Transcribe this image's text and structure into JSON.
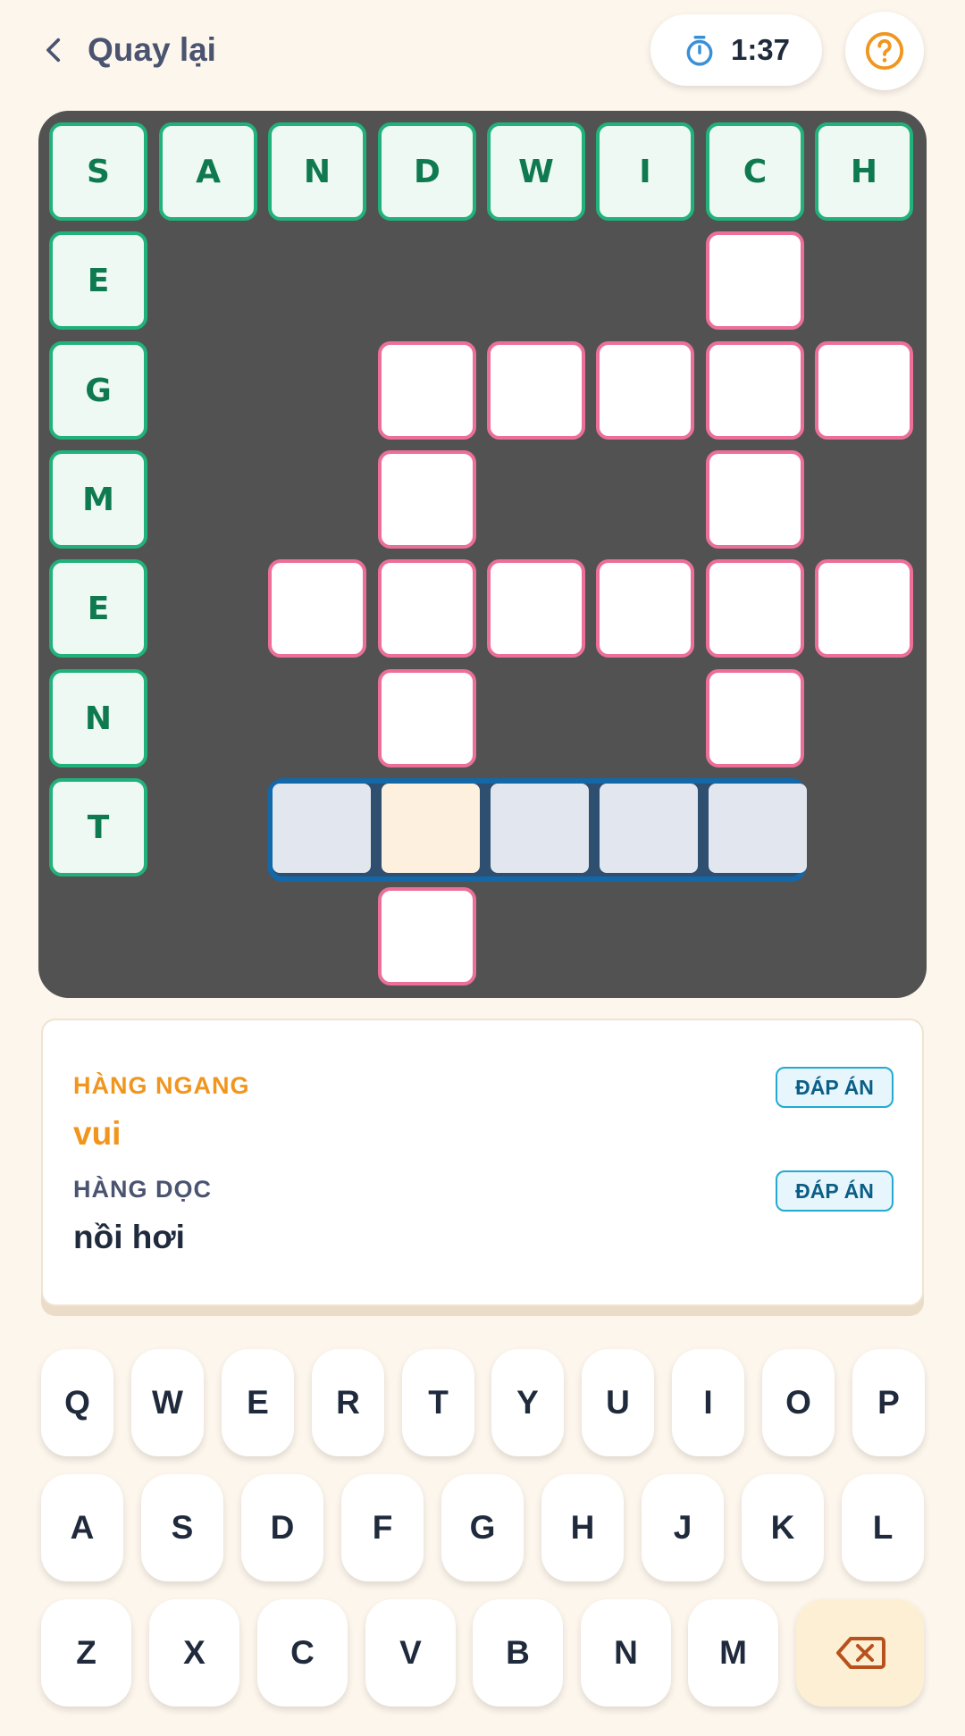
{
  "header": {
    "back_label": "Quay lại",
    "timer": "1:37"
  },
  "board": {
    "solved_row": [
      "S",
      "A",
      "N",
      "D",
      "W",
      "I",
      "C",
      "H"
    ],
    "solved_col": [
      "E",
      "G",
      "M",
      "E",
      "N",
      "T"
    ]
  },
  "clues": {
    "across_heading": "HÀNG NGANG",
    "across_text": "vui",
    "down_heading": "HÀNG DỌC",
    "down_text": "nồi hơi",
    "answer_button": "ĐÁP ÁN"
  },
  "keyboard": {
    "row1": [
      "Q",
      "W",
      "E",
      "R",
      "T",
      "Y",
      "U",
      "I",
      "O",
      "P"
    ],
    "row2": [
      "A",
      "S",
      "D",
      "F",
      "G",
      "H",
      "J",
      "K",
      "L"
    ],
    "row3": [
      "Z",
      "X",
      "C",
      "V",
      "B",
      "N",
      "M"
    ]
  },
  "colors": {
    "accent_orange": "#F0961E",
    "solved_green": "#20B27A",
    "empty_pink": "#EC6F98",
    "active_blue": "#1268A8"
  },
  "icons": {
    "back": "chevron-left-icon",
    "timer": "stopwatch-icon",
    "help": "question-circle-icon",
    "backspace": "backspace-icon"
  }
}
